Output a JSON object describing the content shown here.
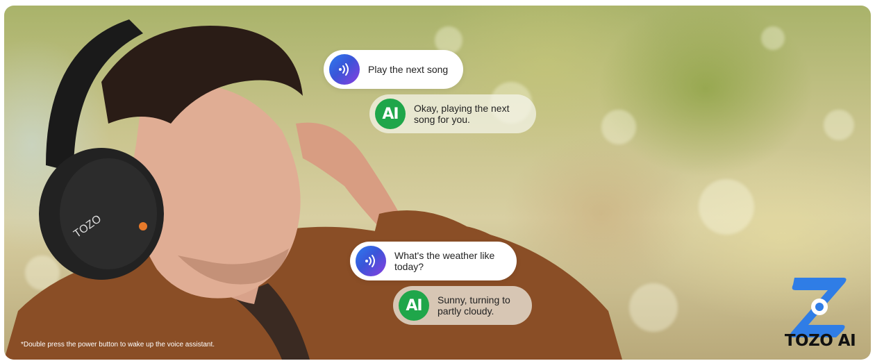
{
  "conversation": [
    {
      "role": "user",
      "text": "Play the next song"
    },
    {
      "role": "ai",
      "badge": "AI",
      "text": "Okay, playing the next song for you."
    },
    {
      "role": "user",
      "text": "What's the weather like today?"
    },
    {
      "role": "ai",
      "badge": "AI",
      "text": "Sunny, turning to partly cloudy."
    }
  ],
  "headphone_brand": "TOZO",
  "footnote": "*Double press the power button to wake up the voice assistant.",
  "logo": {
    "text": "TOZO AI",
    "icon": "tozo-logo-icon"
  },
  "colors": {
    "voice_gradient_start": "#2d7bf0",
    "voice_gradient_end": "#8a3ee0",
    "ai_badge": "#1fa64a",
    "logo_blue": "#2f7de6"
  }
}
